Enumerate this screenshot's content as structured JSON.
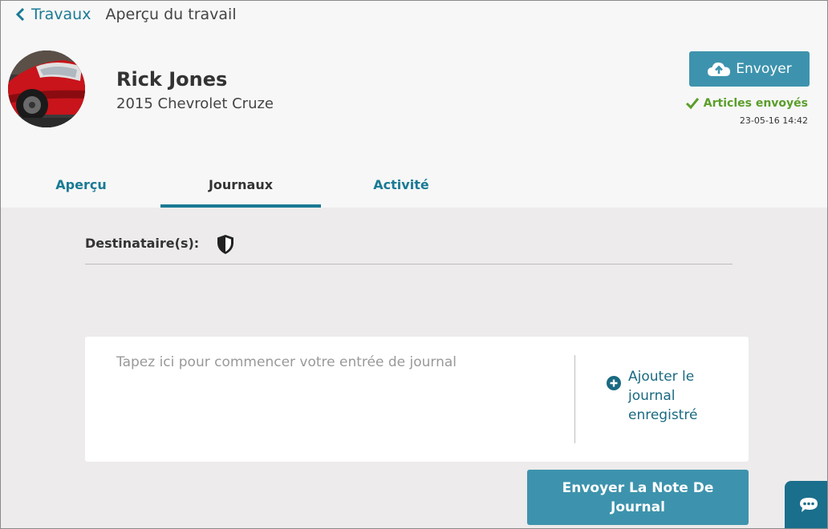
{
  "nav": {
    "back_label": "Travaux",
    "page_title": "Aperçu du travail"
  },
  "customer": {
    "name": "Rick Jones",
    "vehicle": "2015 Chevrolet Cruze"
  },
  "send": {
    "button_label": "Envoyer",
    "status_label": "Articles envoyés",
    "status_time": "23-05-16 14:42"
  },
  "tabs": [
    {
      "label": "Aperçu",
      "active": false
    },
    {
      "label": "Journaux",
      "active": true
    },
    {
      "label": "Activité",
      "active": false
    }
  ],
  "journal": {
    "recipients_label": "Destinataire(s):",
    "placeholder": "Tapez ici pour commencer votre entrée de journal",
    "add_saved_label": "Ajouter le journal enregistré",
    "send_note_label": "Envoyer La Note De Journal"
  },
  "icons": {
    "back": "chevron-left-icon",
    "upload": "cloud-upload-icon",
    "check": "check-icon",
    "shield": "shield-icon",
    "plus": "plus-circle-icon",
    "chat": "chat-icon"
  },
  "colors": {
    "accent": "#1a7a94",
    "button": "#3d93ad",
    "success": "#5a9e2a",
    "content_bg": "#edebeb"
  }
}
